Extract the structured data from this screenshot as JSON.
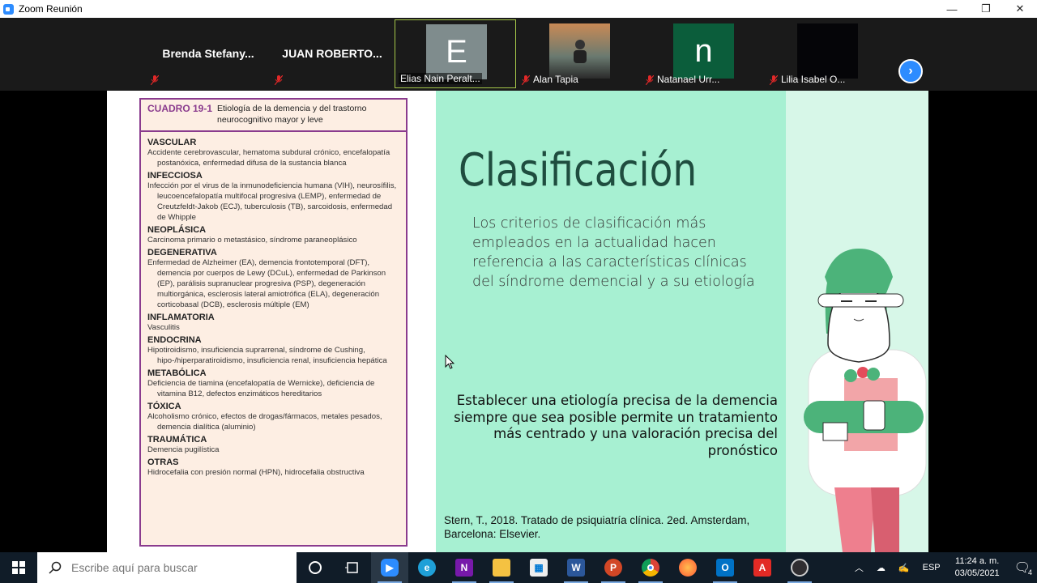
{
  "window": {
    "title": "Zoom Reunión",
    "minimize_glyph": "—",
    "restore_glyph": "❐",
    "close_glyph": "✕"
  },
  "participants": [
    {
      "name": "Brenda  Stefany...",
      "muted": true,
      "video": false
    },
    {
      "name": "JUAN  ROBERTO...",
      "muted": true,
      "video": false
    },
    {
      "name": "Elias Nain Peralt...",
      "avatar_letter": "E",
      "avatar_color": "#7f8c8d",
      "muted": false,
      "active_speaker": true
    },
    {
      "name": "Alan Tapia",
      "muted": true,
      "video": true
    },
    {
      "name": "Natanael Urr...",
      "avatar_letter": "n",
      "avatar_color": "#0b5d3b",
      "muted": true
    },
    {
      "name": "Lilia Isabel O...",
      "muted": true,
      "video": true
    }
  ],
  "next_page_icon": "chevron-right-icon",
  "slide": {
    "box": {
      "number": "CUADRO 19-1",
      "title": "Etiología de la demencia y del trastorno neurocognitivo mayor y leve",
      "categories": [
        {
          "name": "VASCULAR",
          "desc": "Accidente cerebrovascular, hematoma subdural crónico, encefalopatía postanóxica, enfermedad difusa de la sustancia blanca"
        },
        {
          "name": "INFECCIOSA",
          "desc": "Infección por el virus de la inmunodeficiencia humana (VIH), neurosífilis, leucoencefalopatía multifocal progresiva (LEMP), enfermedad de Creutzfeldt-Jakob (ECJ), tuberculosis (TB), sarcoidosis, enfermedad de Whipple"
        },
        {
          "name": "NEOPLÁSICA",
          "desc": "Carcinoma primario o metastásico, síndrome paraneoplásico"
        },
        {
          "name": "DEGENERATIVA",
          "desc": "Enfermedad de Alzheimer (EA), demencia frontotemporal (DFT), demencia por cuerpos de Lewy (DCuL), enfermedad de Parkinson (EP), parálisis supranuclear progresiva (PSP), degeneración multiorgánica, esclerosis lateral amiotrófica (ELA), degeneración corticobasal (DCB), esclerosis múltiple (EM)"
        },
        {
          "name": "INFLAMATORIA",
          "desc": "Vasculitis"
        },
        {
          "name": "ENDOCRINA",
          "desc": "Hipotiroidismo, insuficiencia suprarrenal, síndrome de Cushing, hipo-/hiperparatiroidismo, insuficiencia renal, insuficiencia hepática"
        },
        {
          "name": "METABÓLICA",
          "desc": "Deficiencia de tiamina (encefalopatía de Wernicke), deficiencia de vitamina B12, defectos enzimáticos hereditarios"
        },
        {
          "name": "TÓXICA",
          "desc": "Alcoholismo crónico, efectos de drogas/fármacos, metales pesados, demencia dialítica (aluminio)"
        },
        {
          "name": "TRAUMÁTICA",
          "desc": "Demencia pugilística"
        },
        {
          "name": "OTRAS",
          "desc": "Hidrocefalia con presión normal (HPN), hidrocefalia obstructiva"
        }
      ]
    },
    "title": "Clasificación",
    "paragraph": "Los criterios de clasificación más empleados en la actualidad hacen referencia a las características clínicas del síndrome demencial y a su etiología",
    "note": "Establecer una etiología precisa de la demencia siempre que sea posible permite un tratamiento más centrado y una valoración precisa del pronóstico",
    "reference": "Stern, T., 2018. Tratado de psiquiatría clínica. 2ed. Amsterdam, Barcelona: Elsevier."
  },
  "taskbar": {
    "search_placeholder": "Escribe aquí para buscar",
    "apps": [
      "cortana-icon",
      "task-view-icon",
      "zoom-icon",
      "edge-icon",
      "onenote-icon",
      "file-explorer-icon",
      "store-icon",
      "word-icon",
      "powerpoint-icon",
      "chrome-icon",
      "firefox-icon",
      "outlook-icon",
      "acrobat-icon",
      "obs-icon"
    ],
    "language": "ESP",
    "time": "11:24 a. m.",
    "date": "03/05/2021",
    "notifications": "4"
  }
}
